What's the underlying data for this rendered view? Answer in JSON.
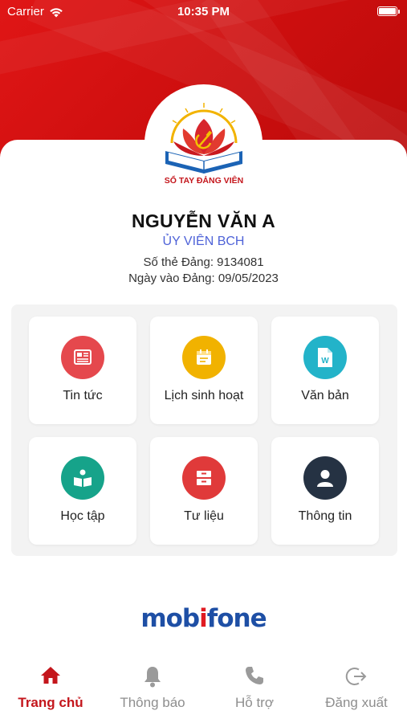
{
  "status_bar": {
    "carrier": "Carrier",
    "time": "10:35 PM"
  },
  "app": {
    "logo_text": "SỔ TAY ĐẢNG VIÊN"
  },
  "profile": {
    "name": "NGUYỄN VĂN A",
    "role": "ỦY VIÊN BCH",
    "card_no": "Số thẻ Đảng: 9134081",
    "join_date": "Ngày vào Đảng: 09/05/2023"
  },
  "menu": [
    {
      "label": "Tin tức",
      "icon": "newspaper-icon",
      "color": "#e5484d"
    },
    {
      "label": "Lịch sinh hoạt",
      "icon": "calendar-icon",
      "color": "#f1b200"
    },
    {
      "label": "Văn bản",
      "icon": "word-document-icon",
      "color": "#23b3c9"
    },
    {
      "label": "Học tập",
      "icon": "open-book-icon",
      "color": "#16a38a"
    },
    {
      "label": "Tư liệu",
      "icon": "archive-icon",
      "color": "#e03a3a"
    },
    {
      "label": "Thông tin",
      "icon": "user-icon",
      "color": "#253243"
    }
  ],
  "footer_brand": {
    "part1": "mob",
    "part2": "i",
    "part3": "fone"
  },
  "tabs": [
    {
      "label": "Trang chủ",
      "icon": "home-icon",
      "active": true
    },
    {
      "label": "Thông báo",
      "icon": "bell-icon",
      "active": false
    },
    {
      "label": "Hỗ trợ",
      "icon": "phone-icon",
      "active": false
    },
    {
      "label": "Đăng xuất",
      "icon": "logout-icon",
      "active": false
    }
  ],
  "colors": {
    "primary_red": "#c4161c",
    "role_blue": "#4f63d8",
    "brand_blue": "#1e4fa5"
  }
}
